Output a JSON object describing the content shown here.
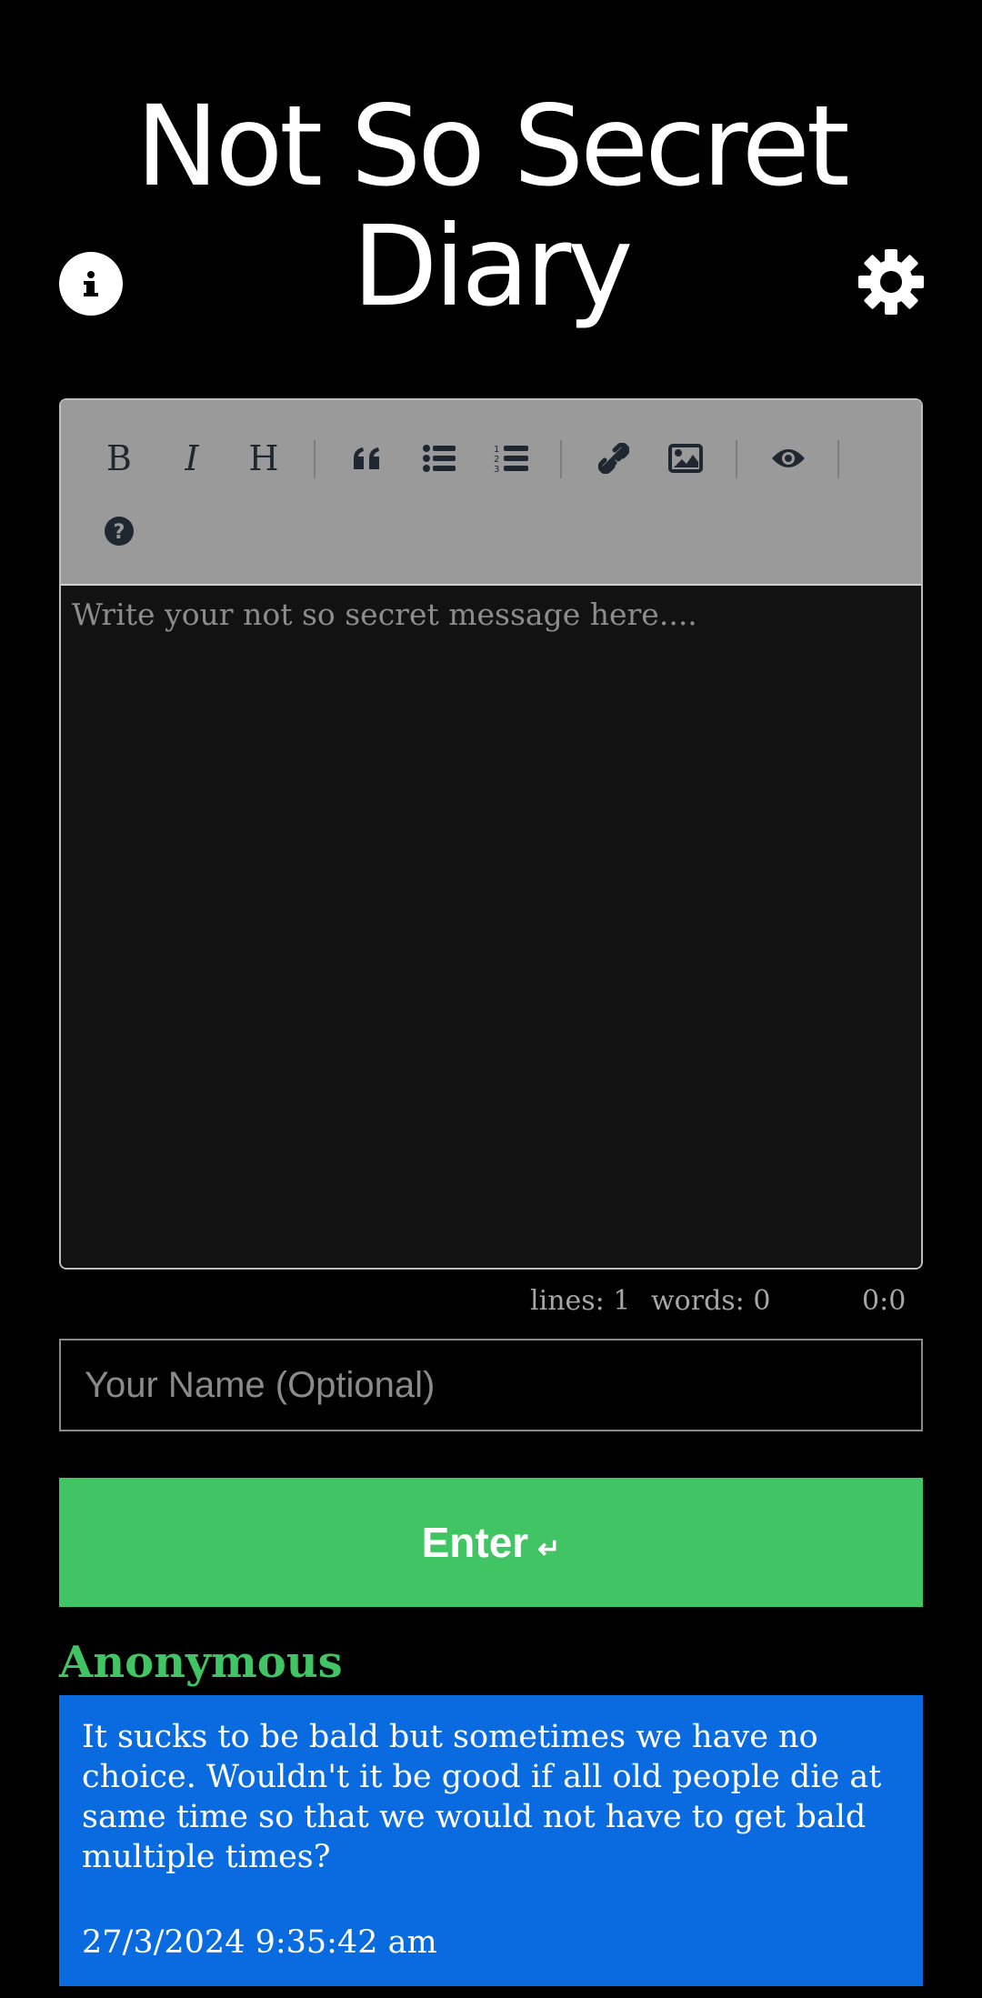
{
  "header": {
    "title_line1": "Not So Secret",
    "title_line2": "Diary",
    "info_icon": "info-circle-icon",
    "settings_icon": "gear-icon"
  },
  "toolbar": {
    "bold": "B",
    "italic": "I",
    "heading": "H",
    "icons": [
      "quote-icon",
      "unordered-list-icon",
      "ordered-list-icon",
      "link-icon",
      "image-icon",
      "preview-eye-icon",
      "help-icon"
    ]
  },
  "editor": {
    "placeholder": "Write your not so secret message here...."
  },
  "status": {
    "lines": "lines: 1",
    "words": "words: 0",
    "cursor": "0:0"
  },
  "form": {
    "name_placeholder": "Your Name (Optional)",
    "enter_label": "Enter",
    "enter_symbol": "↵"
  },
  "post": {
    "author": "Anonymous",
    "message": "It sucks to be bald but sometimes we have no choice. Wouldn't it be good if all old people die at same time so that we would not have to get bald multiple times?",
    "timestamp": "27/3/2024 9:35:42 am"
  },
  "colors": {
    "background": "#000000",
    "accent_green": "#41c463",
    "post_blue": "#0a6be0",
    "toolbar_gray": "#9a9a9a"
  }
}
